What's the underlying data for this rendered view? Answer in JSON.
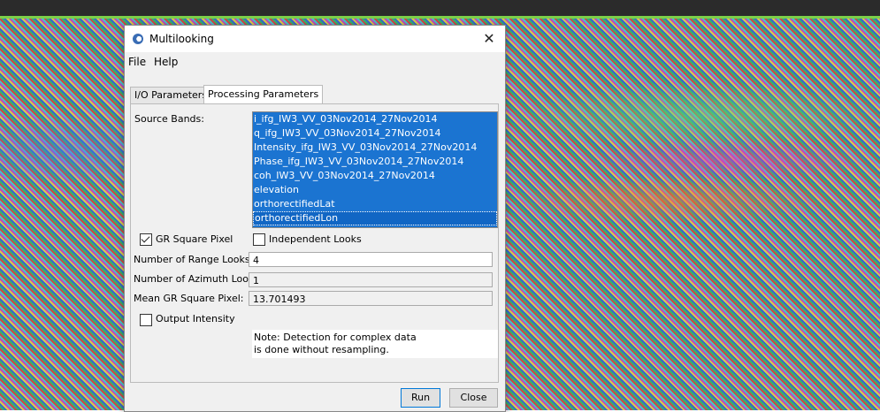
{
  "window": {
    "title": "Multilooking",
    "close_glyph": "✕"
  },
  "menu": {
    "file": "File",
    "help": "Help"
  },
  "tabs": {
    "io": "I/O Parameters",
    "processing": "Processing Parameters"
  },
  "form": {
    "source_bands_label": "Source Bands:",
    "source_bands": [
      "i_ifg_IW3_VV_03Nov2014_27Nov2014",
      "q_ifg_IW3_VV_03Nov2014_27Nov2014",
      "Intensity_ifg_IW3_VV_03Nov2014_27Nov2014",
      "Phase_ifg_IW3_VV_03Nov2014_27Nov2014",
      "coh_IW3_VV_03Nov2014_27Nov2014",
      "elevation",
      "orthorectifiedLat",
      "orthorectifiedLon"
    ],
    "gr_square_pixel_label": "GR Square Pixel",
    "gr_square_pixel_checked": true,
    "independent_looks_label": "Independent Looks",
    "independent_looks_checked": false,
    "range_looks_label": "Number of Range Looks:",
    "range_looks_value": "4",
    "azimuth_looks_label": "Number of Azimuth Looks:",
    "azimuth_looks_value": "1",
    "mean_gr_label": "Mean GR Square Pixel:",
    "mean_gr_value": "13.701493",
    "output_intensity_label": "Output Intensity",
    "output_intensity_checked": false,
    "note_line1": "Note: Detection for complex data",
    "note_line2": "is done without resampling."
  },
  "buttons": {
    "run": "Run",
    "close": "Close"
  },
  "colors": {
    "selection": "#1b74d1",
    "top_accent": "#7ccf4a"
  },
  "icons": {
    "app": "snap-app-icon",
    "close": "close-icon",
    "check": "checkmark-icon"
  }
}
